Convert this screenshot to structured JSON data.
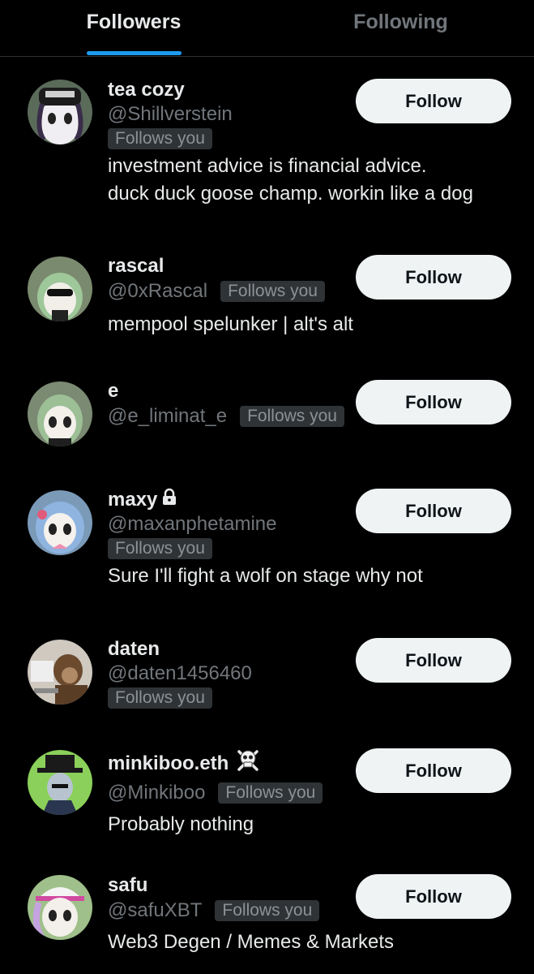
{
  "tabs": {
    "followers": "Followers",
    "following": "Following"
  },
  "colors": {
    "accent": "#1d9bf0",
    "background": "#000000",
    "muted": "#71767b"
  },
  "users": [
    {
      "name": "tea cozy",
      "handle": "@Shillverstein",
      "badge": "Follows you",
      "bio": [
        "investment advice is financial advice.",
        "duck duck goose champ. workin like a dog"
      ],
      "button": "Follow"
    },
    {
      "name": "rascal",
      "handle": "@0xRascal",
      "badge": "Follows you",
      "bio": [
        "mempool spelunker | alt's alt"
      ],
      "button": "Follow"
    },
    {
      "name": "e",
      "handle": "@e_liminat_e",
      "badge": "Follows you",
      "bio": [],
      "button": "Follow"
    },
    {
      "name": "maxy",
      "name_icon": "lock-icon",
      "handle": "@maxanphetamine",
      "badge": "Follows you",
      "bio": [
        "Sure I'll fight a wolf on stage why not"
      ],
      "button": "Follow"
    },
    {
      "name": "daten",
      "handle": "@daten1456460",
      "badge": "Follows you",
      "bio": [],
      "button": "Follow"
    },
    {
      "name": "minkiboo.eth",
      "name_icon": "skull-crossbones-icon",
      "handle": "@Minkiboo",
      "badge": "Follows you",
      "bio": [
        "Probably nothing"
      ],
      "button": "Follow"
    },
    {
      "name": "safu",
      "handle": "@safuXBT",
      "badge": "Follows you",
      "bio": [
        "Web3 Degen / Memes & Markets"
      ],
      "button": "Follow"
    }
  ]
}
